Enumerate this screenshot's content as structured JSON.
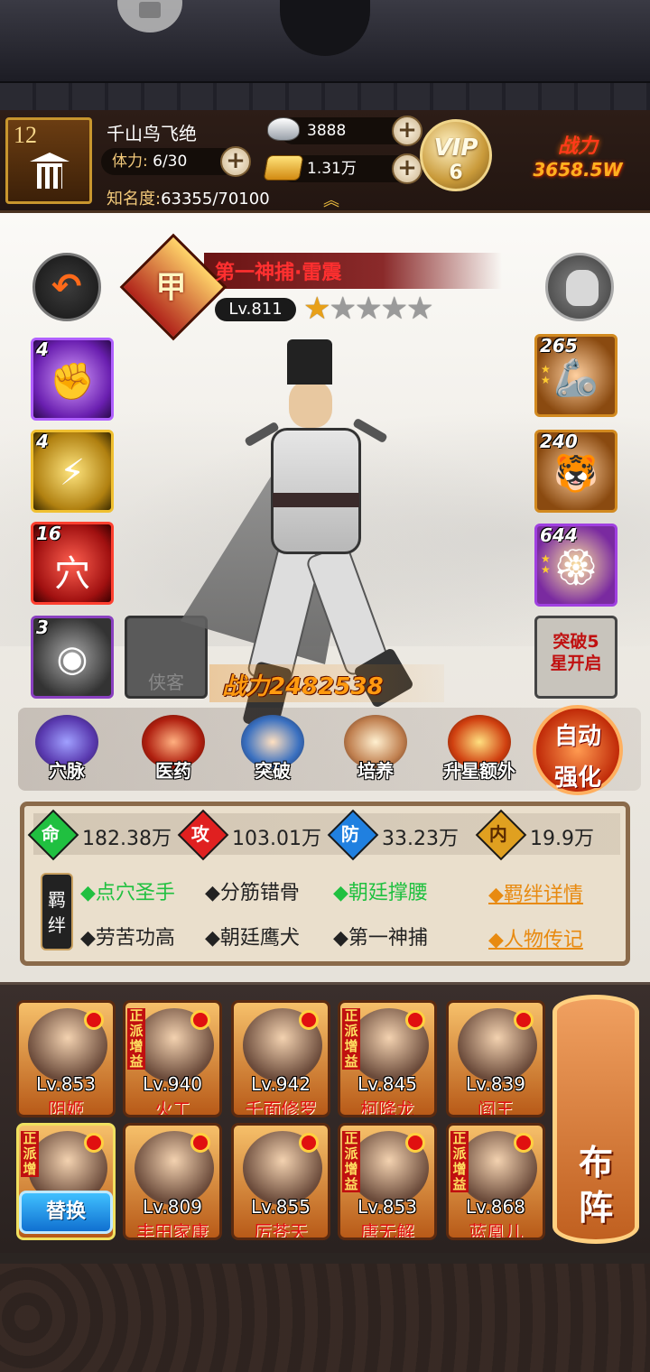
{
  "player": {
    "level": "12",
    "name": "千山鸟飞绝",
    "stamina_label": "体力:",
    "stamina": "6/30",
    "fame_label": "知名度:",
    "fame": "63355/70100",
    "silver": "3888",
    "gold": "1.31万",
    "vip_label": "VIP",
    "vip_level": "6",
    "power_label": "战力",
    "power_value": "3658.5W"
  },
  "hero": {
    "name": "第一神捕·雷震",
    "rank_glyph": "甲",
    "level": "Lv.811",
    "stars": 1,
    "max_stars": 5,
    "battle_power": "战力2482538"
  },
  "skills_left": [
    {
      "level": "4",
      "icon": "fist-icon"
    },
    {
      "level": "4",
      "icon": "claw-icon"
    },
    {
      "level": "16",
      "icon": "acupoint-icon",
      "glyph": "穴"
    },
    {
      "level": "3",
      "icon": "medallion-icon"
    }
  ],
  "empty_slot_label": "侠客",
  "equip_right": [
    {
      "level": "265",
      "icon": "gauntlet-icon"
    },
    {
      "level": "240",
      "icon": "tiger-armor-icon"
    },
    {
      "level": "644",
      "icon": "jade-pendant-icon"
    }
  ],
  "break_slot": {
    "line1": "突破5",
    "line2": "星开启"
  },
  "functions": [
    {
      "label": "穴脉",
      "icon": "meridian-icon"
    },
    {
      "label": "医药",
      "icon": "medicine-icon"
    },
    {
      "label": "突破",
      "icon": "breakthrough-icon"
    },
    {
      "label": "培养",
      "icon": "scroll-icon"
    },
    {
      "label": "升星额外",
      "icon": "treasure-icon"
    }
  ],
  "auto_button": {
    "line1": "自动",
    "line2": "强化"
  },
  "attributes": [
    {
      "glyph": "命",
      "value": "182.38万",
      "color": "#20c040"
    },
    {
      "glyph": "攻",
      "value": "103.01万",
      "color": "#e02020"
    },
    {
      "glyph": "防",
      "value": "33.23万",
      "color": "#2080e0"
    },
    {
      "glyph": "内",
      "value": "19.9万",
      "color": "#e0a020"
    }
  ],
  "bond_tag": {
    "line1": "羁",
    "line2": "绊"
  },
  "bonds": [
    {
      "text": "◆点穴圣手",
      "active": true
    },
    {
      "text": "◆分筋错骨",
      "active": false
    },
    {
      "text": "◆朝廷撑腰",
      "active": true
    },
    {
      "text": "◆劳苦功高",
      "active": false
    },
    {
      "text": "◆朝廷鹰犬",
      "active": false
    },
    {
      "text": "◆第一神捕",
      "active": false
    }
  ],
  "bond_links": {
    "details": "◆羁绊详情",
    "biography": "◆人物传记"
  },
  "team": [
    {
      "level": "Lv.853",
      "name": "阴姬",
      "tag": ""
    },
    {
      "level": "Lv.940",
      "name": "火工",
      "tag": "正派增益"
    },
    {
      "level": "Lv.942",
      "name": "千面修罗",
      "tag": ""
    },
    {
      "level": "Lv.845",
      "name": "柯降龙",
      "tag": "正派增益"
    },
    {
      "level": "Lv.839",
      "name": "阎王",
      "tag": ""
    },
    {
      "level": "",
      "name": "",
      "tag": "正派增",
      "swap_label": "替换"
    },
    {
      "level": "Lv.809",
      "name": "丰田家康",
      "tag": ""
    },
    {
      "level": "Lv.855",
      "name": "厉苍天",
      "tag": ""
    },
    {
      "level": "Lv.853",
      "name": "唐无解",
      "tag": "正派增益"
    },
    {
      "level": "Lv.868",
      "name": "蓝凰儿",
      "tag": "正派增益"
    }
  ],
  "formation": {
    "line1": "布",
    "line2": "阵"
  }
}
